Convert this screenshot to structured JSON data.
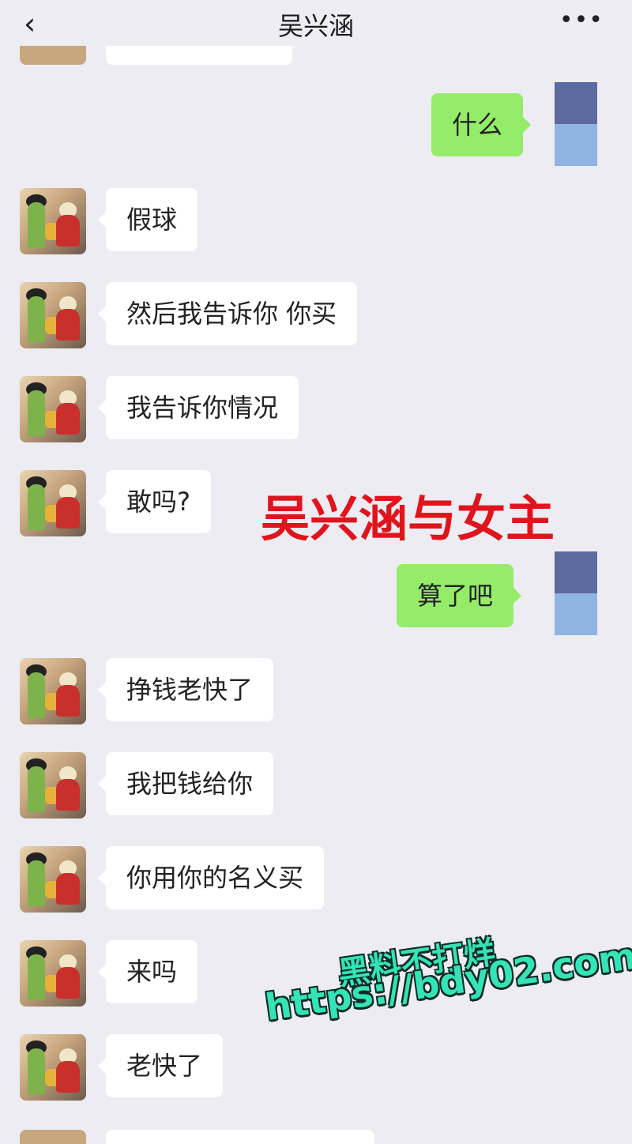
{
  "header": {
    "back_icon": "chevron-left-icon",
    "title": "吴兴涵",
    "more_icon": "more-dots-icon",
    "more_glyph": "•••"
  },
  "messages": [
    {
      "side": "out",
      "text": "什么"
    },
    {
      "side": "in",
      "text": "假球"
    },
    {
      "side": "in",
      "text": "然后我告诉你 你买"
    },
    {
      "side": "in",
      "text": "我告诉你情况"
    },
    {
      "side": "in",
      "text": "敢吗?"
    },
    {
      "side": "out",
      "text": "算了吧"
    },
    {
      "side": "in",
      "text": "挣钱老快了"
    },
    {
      "side": "in",
      "text": "我把钱给你"
    },
    {
      "side": "in",
      "text": "你用你的名义买"
    },
    {
      "side": "in",
      "text": "来吗"
    },
    {
      "side": "in",
      "text": "老快了"
    }
  ],
  "overlay": {
    "caption": "吴兴涵与女主",
    "caption_color": "#e0141c",
    "watermark_line1": "黑料不打烊",
    "watermark_line2": "https://bdy02.com",
    "watermark_color": "#34e3b6"
  },
  "colors": {
    "background": "#ececf2",
    "incoming_bubble": "#ffffff",
    "outgoing_bubble": "#95ec69"
  }
}
